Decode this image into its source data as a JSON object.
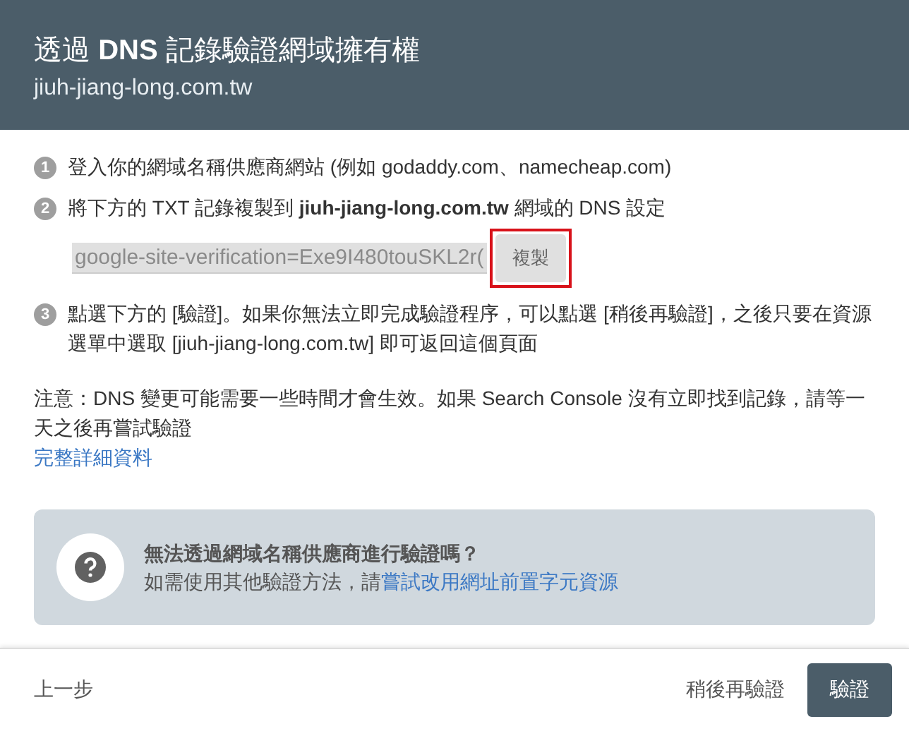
{
  "header": {
    "title": "透過 **DNS** 記錄驗證網域擁有權",
    "subtitle": "jiuh-jiang-long.com.tw"
  },
  "steps": [
    {
      "number": "1",
      "text": "登入你的網域名稱供應商網站 (例如 godaddy.com、namecheap.com)"
    },
    {
      "number": "2",
      "text": "將下方的 TXT 記錄複製到 **jiuh-jiang-long.com.tw** 網域的 DNS 設定",
      "record": {
        "value": "google-site-verification=Exe9I480touSKL2r(",
        "copy_label": "複製",
        "copy_highlighted": true
      }
    },
    {
      "number": "3",
      "text": "點選下方的 [驗證]。如果你無法立即完成驗證程序，可以點選 [稍後再驗證]，之後只要在資源選單中選取 [jiuh-jiang-long.com.tw] 即可返回這個頁面"
    }
  ],
  "note": "注意：DNS 變更可能需要一些時間才會生效。如果 Search Console 沒有立即找到記錄，請等一天之後再嘗試驗證",
  "details_link": "完整詳細資料",
  "help_card": {
    "title": "無法透過網域名稱供應商進行驗證嗎？",
    "text": "如需使用其他驗證方法，請",
    "link": "嘗試改用網址前置字元資源"
  },
  "footer": {
    "back": "上一步",
    "later": "稍後再驗證",
    "verify": "驗證"
  }
}
